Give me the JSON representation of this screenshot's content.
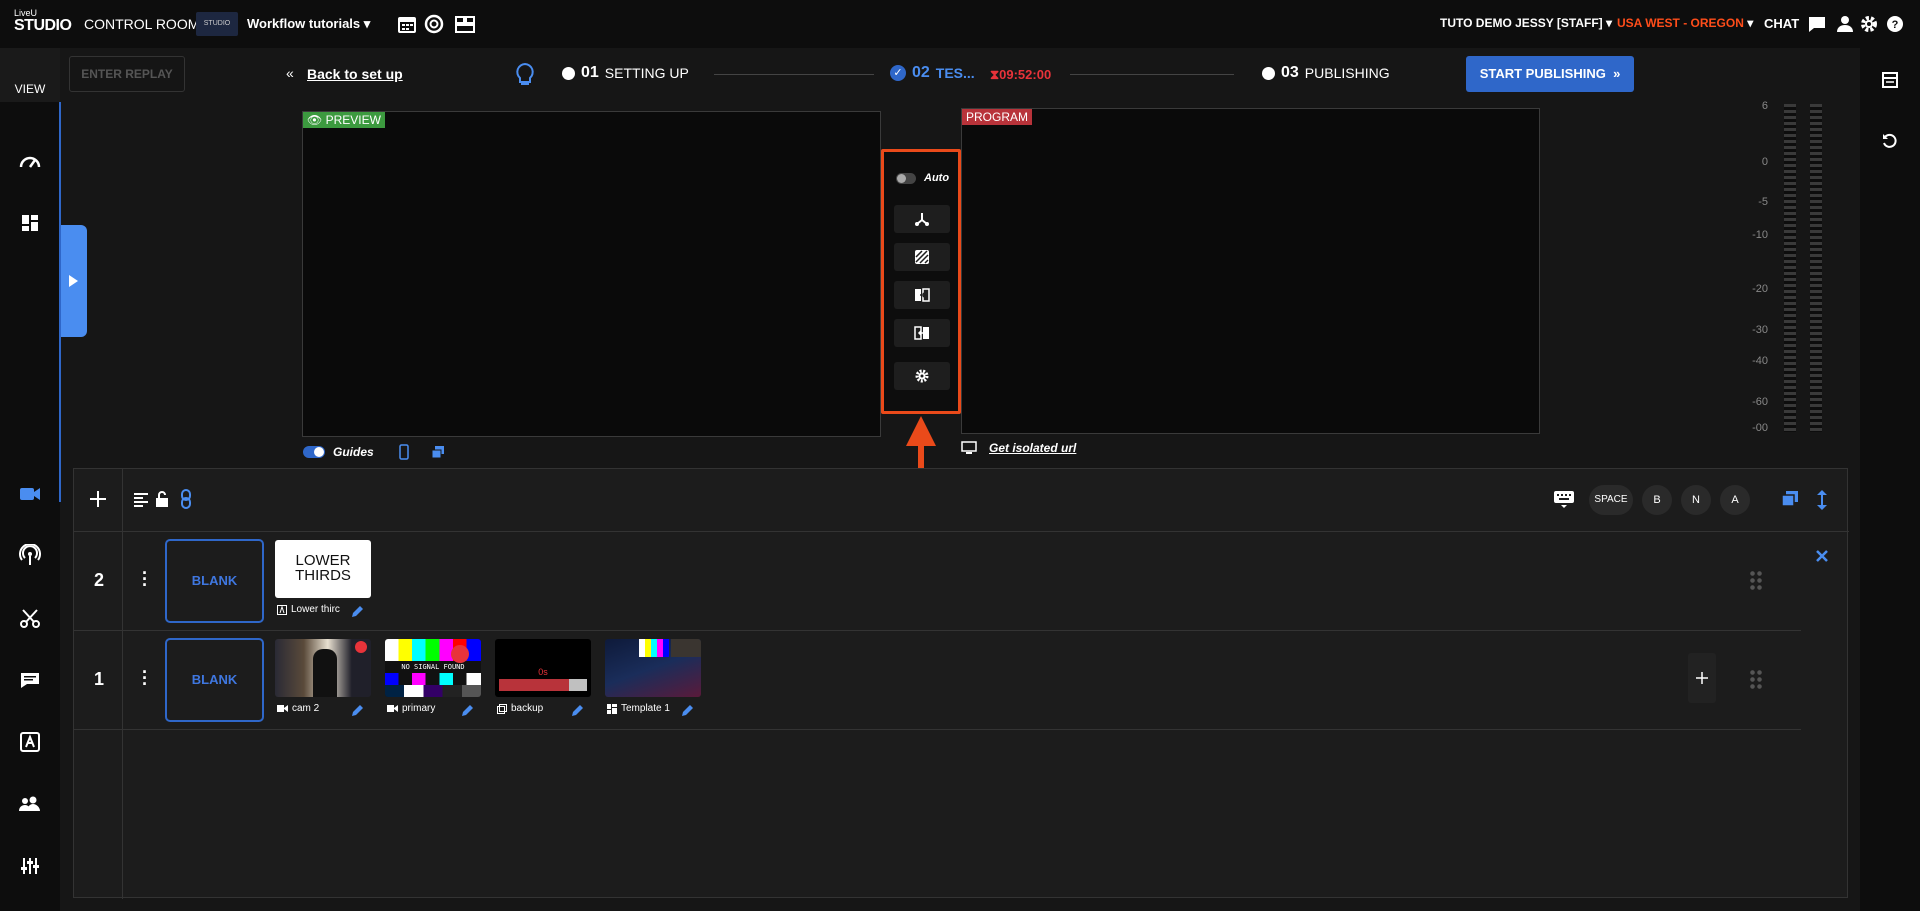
{
  "app": {
    "logo_top": "LiveU",
    "logo_bottom": "STUDIO"
  },
  "topbar": {
    "control_rooms": "CONTROL ROOMS",
    "workspace_name": "Workflow tutorials",
    "workspace_thumb": "STUDIO",
    "user": "TUTO DEMO JESSY [STAFF]",
    "region": "USA WEST - OREGON",
    "chat": "CHAT"
  },
  "sidebar": {
    "view_label": "VIEW"
  },
  "toolbar": {
    "replay": "ENTER REPLAY",
    "back": "Back to set up",
    "steps": [
      {
        "num": "01",
        "label": "SETTING UP"
      },
      {
        "num": "02",
        "label": "TES..."
      },
      {
        "num": "03",
        "label": "PUBLISHING"
      }
    ],
    "timer": "09:52:00",
    "start": "START PUBLISHING"
  },
  "monitors": {
    "preview": "PREVIEW",
    "program": "PROGRAM",
    "guides": "Guides",
    "isolated": "Get isolated url"
  },
  "transitions": {
    "auto": "Auto"
  },
  "meter": {
    "labels": [
      "6",
      "0",
      "-5",
      "-10",
      "-20",
      "-30",
      "-40",
      "-60",
      "-00"
    ]
  },
  "layers": {
    "shortcuts": [
      "SPACE",
      "B",
      "N",
      "A"
    ],
    "rows": [
      {
        "num": "2",
        "blank": "BLANK",
        "sources": [
          {
            "label": "Lower thirc",
            "thumb_text": "LOWER THIRDS"
          }
        ]
      },
      {
        "num": "1",
        "blank": "BLANK",
        "sources": [
          {
            "label": "cam 2"
          },
          {
            "label": "primary",
            "thumb_text": "NO SIGNAL FOUND"
          },
          {
            "label": "backup",
            "thumb_text": "0s"
          },
          {
            "label": "Template 1"
          }
        ]
      }
    ]
  },
  "colors": {
    "accent": "#2f67c9",
    "highlight": "#ea4a1a",
    "preview": "#3c9a3f",
    "program": "#b8333a",
    "region": "#ff4d1a"
  }
}
